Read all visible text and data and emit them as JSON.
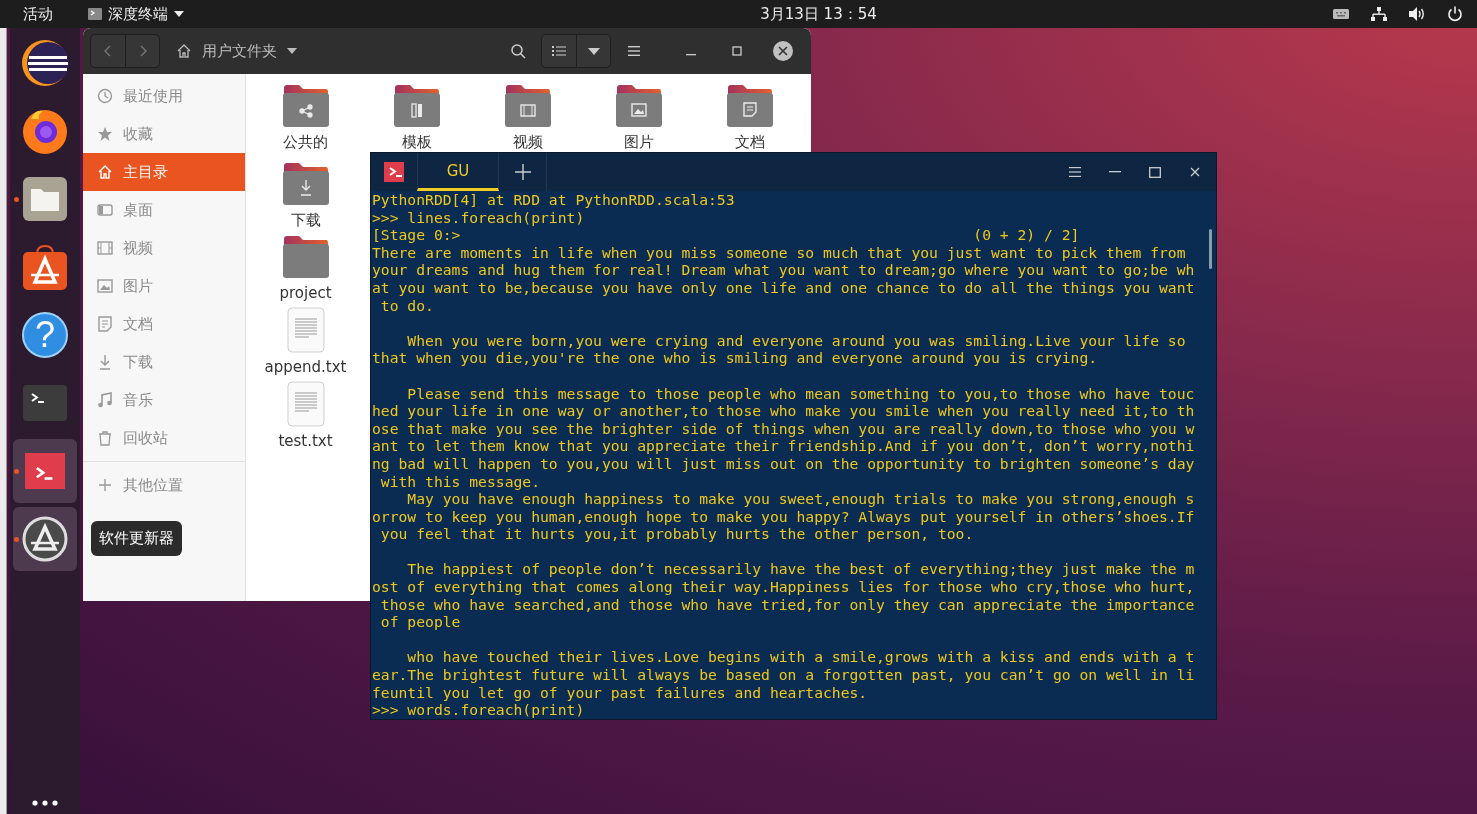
{
  "top_bar": {
    "activities": "活动",
    "app_menu": "深度终端",
    "clock": "3月13日 13：54"
  },
  "dock": {
    "items": [
      {
        "kind": "eclipse",
        "running": false,
        "selected": false
      },
      {
        "kind": "firefox",
        "running": false,
        "selected": false
      },
      {
        "kind": "files",
        "running": true,
        "selected": false
      },
      {
        "kind": "software",
        "running": false,
        "selected": false
      },
      {
        "kind": "help",
        "running": false,
        "selected": false,
        "glyph": "?"
      },
      {
        "kind": "terminal",
        "running": false,
        "selected": false
      },
      {
        "kind": "deepin",
        "running": true,
        "selected": true
      },
      {
        "kind": "updater",
        "running": true,
        "selected": true
      }
    ],
    "tooltip": "软件更新器"
  },
  "files_window": {
    "path": "用户文件夹",
    "sidebar": [
      {
        "kind": "recent",
        "label": "最近使用",
        "selected": false
      },
      {
        "kind": "starred",
        "label": "收藏",
        "selected": false
      },
      {
        "kind": "home",
        "label": "主目录",
        "selected": true
      },
      {
        "kind": "desktop",
        "label": "桌面",
        "selected": false
      },
      {
        "kind": "videos",
        "label": "视频",
        "selected": false
      },
      {
        "kind": "pictures",
        "label": "图片",
        "selected": false
      },
      {
        "kind": "documents",
        "label": "文档",
        "selected": false
      },
      {
        "kind": "downloads",
        "label": "下载",
        "selected": false
      },
      {
        "kind": "music",
        "label": "音乐",
        "selected": false
      },
      {
        "kind": "trash",
        "label": "回收站",
        "selected": false
      },
      {
        "kind": "other",
        "label": "其他位置",
        "selected": false
      }
    ],
    "top_row": [
      {
        "kind": "shared",
        "name": "公共的"
      },
      {
        "kind": "templates",
        "name": "模板"
      },
      {
        "kind": "videos",
        "name": "视频"
      },
      {
        "kind": "pictures",
        "name": "图片"
      },
      {
        "kind": "documents",
        "name": "文档"
      }
    ],
    "first_column": [
      {
        "kind": "downloads",
        "name": "下载"
      },
      {
        "kind": "folder",
        "name": "project"
      },
      {
        "kind": "file",
        "name": "append.txt"
      },
      {
        "kind": "file",
        "name": "test.txt"
      }
    ]
  },
  "terminal": {
    "tabs": [
      {
        "label": "GU",
        "selected": true
      }
    ],
    "blocks": [
      [
        "PythonRDD[4] at RDD at PythonRDD.scala:53",
        ">>> lines.foreach(print)",
        "[Stage 0:>                                                          (0 + 2) / 2]",
        "There are moments in life when you miss someone so much that you just want to pick them from",
        "your dreams and hug them for real! Dream what you want to dream;go where you want to go;be wh",
        "at you want to be,because you have only one life and one chance to do all the things you want",
        " to do."
      ],
      [
        "    When you were born,you were crying and everyone around you was smiling.Live your life so",
        "that when you die,you're the one who is smiling and everyone around you is crying."
      ],
      [
        "    Please send this message to those people who mean something to you,to those who have touc",
        "hed your life in one way or another,to those who make you smile when you really need it,to th",
        "ose that make you see the brighter side of things when you are really down,to those who you w",
        "ant to let them know that you appreciate their friendship.And if you don’t, don’t worry,nothi",
        "ng bad will happen to you,you will just miss out on the opportunity to brighten someone’s day",
        " with this message.",
        "    May you have enough happiness to make you sweet,enough trials to make you strong,enough s",
        "orrow to keep you human,enough hope to make you happy? Always put yourself in others’shoes.If",
        " you feel that it hurts you,it probably hurts the other person, too."
      ],
      [
        "    The happiest of people don’t necessarily have the best of everything;they just make the m",
        "ost of everything that comes along their way.Happiness lies for those who cry,those who hurt,",
        " those who have searched,and those who have tried,for only they can appreciate the importance",
        " of people"
      ],
      [
        "    who have touched their lives.Love begins with a smile,grows with a kiss and ends with a t",
        "ear.The brightest future will always be based on a forgotten past, you can’t go on well in li",
        "feuntil you let go of your past failures and heartaches.",
        ">>> words.foreach(print)"
      ]
    ]
  }
}
